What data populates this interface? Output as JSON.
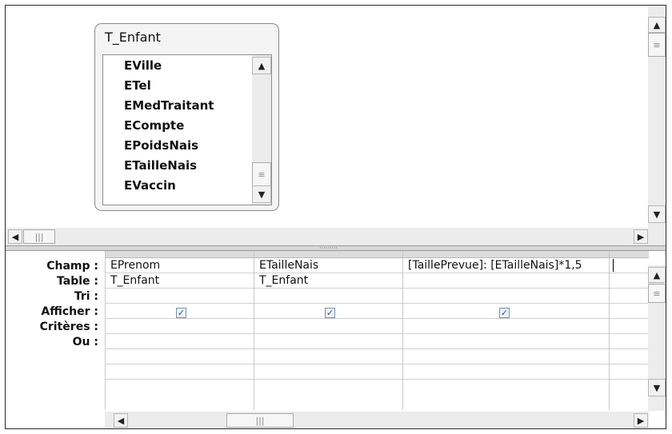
{
  "table": {
    "title": "T_Enfant",
    "fields": [
      "EVille",
      "ETel",
      "EMedTraitant",
      "ECompte",
      "EPoidsNais",
      "ETailleNais",
      "EVaccin"
    ]
  },
  "grid": {
    "row_labels": [
      "Champ :",
      "Table :",
      "Tri :",
      "Afficher :",
      "Critères :",
      "Ou :"
    ],
    "columns": [
      {
        "champ": "EPrenom",
        "table": "T_Enfant",
        "afficher": true
      },
      {
        "champ": "ETailleNais",
        "table": "T_Enfant",
        "afficher": true
      },
      {
        "champ": "[TaillePrevue]: [ETailleNais]*1,5",
        "table": "",
        "afficher": true
      }
    ]
  },
  "glyphs": {
    "arrow_up": "▲",
    "arrow_down": "▼",
    "arrow_left": "◀",
    "arrow_right": "▶",
    "thumb_grip_v": "≡",
    "thumb_grip_h": "|||",
    "check": "✓",
    "splitter_grip": "·········"
  }
}
